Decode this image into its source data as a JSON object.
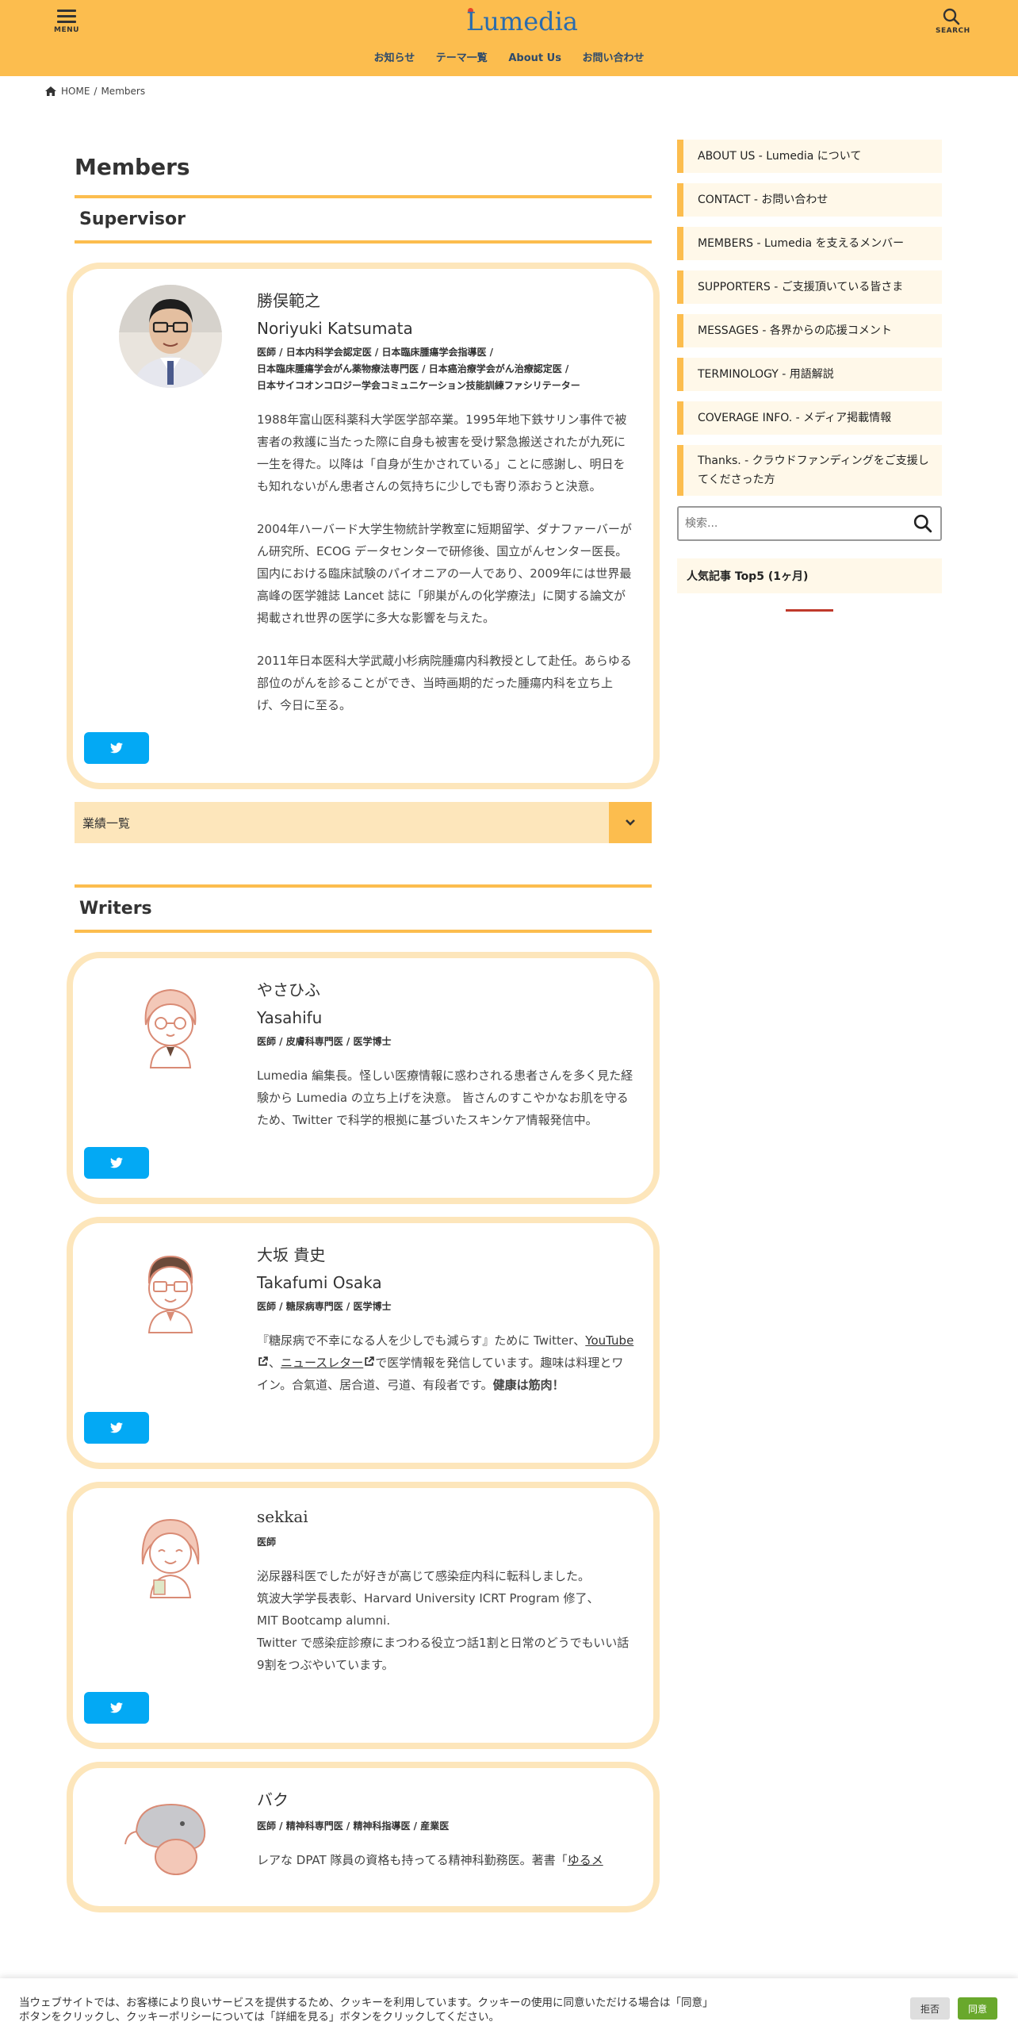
{
  "header": {
    "menu_label": "MENU",
    "search_label": "SEARCH",
    "logo": "Lumedia",
    "nav": [
      "お知らせ",
      "テーマ一覧",
      "About Us",
      "お問い合わせ"
    ]
  },
  "breadcrumb": {
    "home": "HOME",
    "separator": "/",
    "current": "Members"
  },
  "page_title": "Members",
  "supervisor": {
    "section_title": "Supervisor",
    "name_jp": "勝俣範之",
    "name_en": "Noriyuki Katsumata",
    "credentials": "医師 / 日本内科学会認定医 / 日本臨床腫瘍学会指導医 /\n日本臨床腫瘍学会がん薬物療法専門医 / 日本癌治療学会がん治療認定医 /\n日本サイコオンコロジー学会コミュニケーション技能訓練ファシリテーター",
    "bio": [
      "1988年富山医科薬科大学医学部卒業。1995年地下鉄サリン事件で被害者の救護に当たった際に自身も被害を受け緊急搬送されたが九死に一生を得た。以降は「自身が生かされている」ことに感謝し、明日をも知れないがん患者さんの気持ちに少しでも寄り添おうと決意。",
      "2004年ハーバード大学生物統計学教室に短期留学、ダナファーバーがん研究所、ECOG データセンターで研修後、国立がんセンター医長。国内における臨床試験のパイオニアの一人であり、2009年には世界最高峰の医学雑誌 Lancet 誌に「卵巣がんの化学療法」に関する論文が掲載され世界の医学に多大な影響を与えた。",
      "2011年日本医科大学武蔵小杉病院腫瘍内科教授として赴任。あらゆる部位のがんを診ることができ、当時画期的だった腫瘍内科を立ち上げ、今日に至る。"
    ],
    "accordion_label": "業績一覧"
  },
  "writers": {
    "section_title": "Writers",
    "members": [
      {
        "name_jp": "やさひふ",
        "name_en": "Yasahifu",
        "credentials": "医師 / 皮膚科専門医 / 医学博士",
        "bio": "Lumedia 編集長。怪しい医療情報に惑わされる患者さんを多く見た経験から Lumedia の立ち上げを決意。 皆さんのすこやかなお肌を守るため、Twitter で科学的根拠に基づいたスキンケア情報発信中。"
      },
      {
        "name_jp": "大坂 貴史",
        "name_en": "Takafumi Osaka",
        "credentials": "医師 / 糖尿病専門医 / 医学博士",
        "bio_start": "『糖尿病で不幸になる人を少しでも減らす』ために Twitter、",
        "link_youtube": "YouTube",
        "bio_sep": "、",
        "link_newsletter": "ニュースレター",
        "bio_mid": "で医学情報を発信しています。趣味は料理とワイン。合氣道、居合道、弓道、有段者です。",
        "bio_bold": "健康は筋肉！"
      },
      {
        "name_jp": "sekkai",
        "credentials": "医師",
        "bio_lines": [
          "泌尿器科医でしたが好きが高じて感染症内科に転科しました。",
          "筑波大学学長表彰、Harvard University ICRT Program 修了、",
          "MIT Bootcamp alumni.",
          "Twitter で感染症診療にまつわる役立つ話1割と日常のどうでもいい話9割をつぶやいています。"
        ]
      },
      {
        "name_jp": "バク",
        "credentials": "医師 / 精神科専門医 / 精神科指導医 / 産業医",
        "bio_start": "レアな DPAT 隊員の資格も持ってる精神科勤務医。著書「",
        "link_book": "ゆるメ"
      }
    ]
  },
  "sidebar": {
    "links": [
      "ABOUT US - Lumedia について",
      "CONTACT - お問い合わせ",
      "MEMBERS - Lumedia を支えるメンバー",
      "SUPPORTERS - ご支援頂いている皆さま",
      "MESSAGES - 各界からの応援コメント",
      "TERMINOLOGY - 用語解説",
      "COVERAGE INFO. - メディア掲載情報",
      "Thanks. - クラウドファンディングをご支援してくださった方"
    ],
    "search_placeholder": "検索...",
    "popular_title": "人気記事 Top5 (1ヶ月)"
  },
  "cookie": {
    "text": "当ウェブサイトでは、お客様により良いサービスを提供するため、クッキーを利用しています。クッキーの使用に同意いただける場合は「同意」ボタンをクリックし、クッキーポリシーについては「詳細を見る」ボタンをクリックしてください。",
    "reject": "拒否",
    "accept": "同意"
  },
  "colors": {
    "header": "#fcbd4e",
    "card_border": "#fde6bb",
    "twitter": "#03a9f4",
    "accept": "#69a82c"
  },
  "icons": [
    "menu-icon",
    "search-icon",
    "home-icon",
    "twitter-icon",
    "chevron-down-icon",
    "external-link-icon"
  ]
}
